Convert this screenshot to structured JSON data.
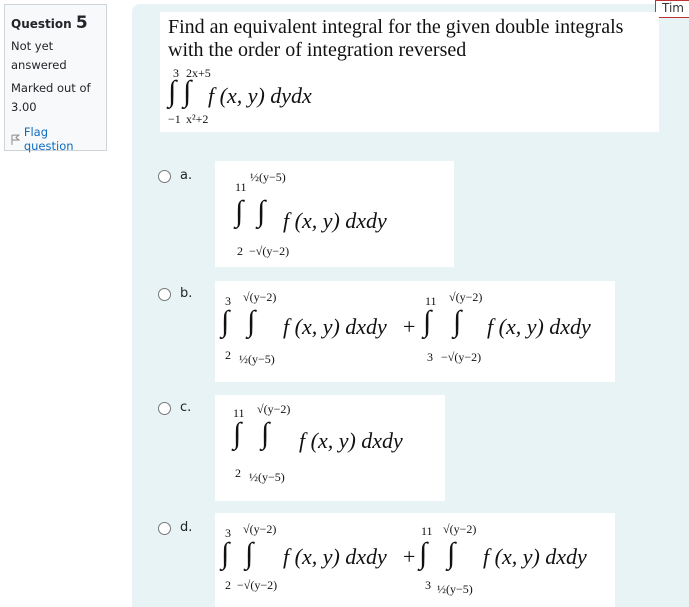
{
  "question_info": {
    "label": "Question",
    "number": "5",
    "status": "Not yet answered",
    "marked_out_of": "Marked out of 3.00",
    "flag_label": "Flag question",
    "flag_icon": "flag-outline-icon"
  },
  "timer": {
    "label": "Tim"
  },
  "question": {
    "text": "Find an equivalent integral for the given double integrals with the order of integration reversed",
    "integral": {
      "outer_upper": "3",
      "outer_lower": "−1",
      "inner_upper": "2x+5",
      "inner_lower": "x²+2",
      "integrand": "f (x, y) dydx"
    }
  },
  "options": [
    {
      "letter": "a.",
      "terms": [
        {
          "outer_upper": "11",
          "outer_lower": "2",
          "inner_upper": "½(y−5)",
          "inner_lower": "−√(y−2)",
          "integrand": "f (x, y) dxdy"
        }
      ]
    },
    {
      "letter": "b.",
      "terms": [
        {
          "outer_upper": "3",
          "outer_lower": "2",
          "inner_upper": "√(y−2)",
          "inner_lower": "½(y−5)",
          "integrand": "f (x, y) dxdy"
        },
        {
          "outer_upper": "11",
          "outer_lower": "3",
          "inner_upper": "√(y−2)",
          "inner_lower": "−√(y−2)",
          "integrand": "f (x, y) dxdy"
        }
      ]
    },
    {
      "letter": "c.",
      "terms": [
        {
          "outer_upper": "11",
          "outer_lower": "2",
          "inner_upper": "√(y−2)",
          "inner_lower": "½(y−5)",
          "integrand": "f (x, y) dxdy"
        }
      ]
    },
    {
      "letter": "d.",
      "terms": [
        {
          "outer_upper": "3",
          "outer_lower": "2",
          "inner_upper": "√(y−2)",
          "inner_lower": "−√(y−2)",
          "integrand": "f (x, y) dxdy"
        },
        {
          "outer_upper": "11",
          "outer_lower": "3",
          "inner_upper": "√(y−2)",
          "inner_lower": "½(y−5)",
          "integrand": "f (x, y) dxdy"
        }
      ]
    }
  ],
  "plus_sign": "+"
}
